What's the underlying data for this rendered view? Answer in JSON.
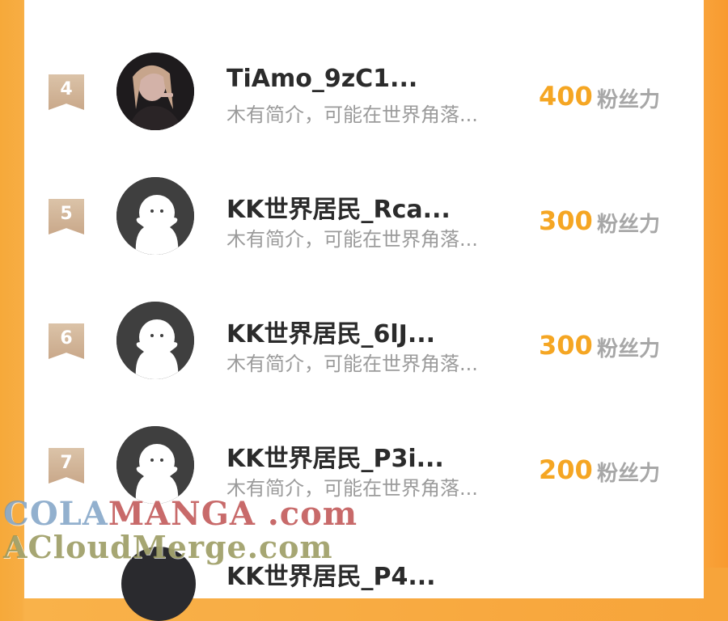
{
  "ranking": {
    "partial_bottom_name": "KK世界居民_P4...",
    "rows": [
      {
        "rank": "4",
        "username": "TiAmo_9zC1...",
        "bio": "木有简介，可能在世界角落...",
        "score": "400",
        "unit": "粉丝力",
        "avatar": "photo-avatar"
      },
      {
        "rank": "5",
        "username": "KK世界居民_Rca...",
        "bio": "木有简介，可能在世界角落...",
        "score": "300",
        "unit": "粉丝力",
        "avatar": "default-avatar"
      },
      {
        "rank": "6",
        "username": "KK世界居民_6lJ...",
        "bio": "木有简介，可能在世界角落...",
        "score": "300",
        "unit": "粉丝力",
        "avatar": "default-avatar"
      },
      {
        "rank": "7",
        "username": "KK世界居民_P3i...",
        "bio": "木有简介，可能在世界角落...",
        "score": "200",
        "unit": "粉丝力",
        "avatar": "default-avatar"
      }
    ]
  },
  "watermark": {
    "line1_blue": "COLA",
    "line1_red": "MANGA",
    "line1_suffix": " .com",
    "line2": "ACloudMerge.com"
  },
  "colors": {
    "background_orange": "#f7a43a",
    "score_orange": "#f5a623",
    "badge_tan": "#d2b497"
  }
}
